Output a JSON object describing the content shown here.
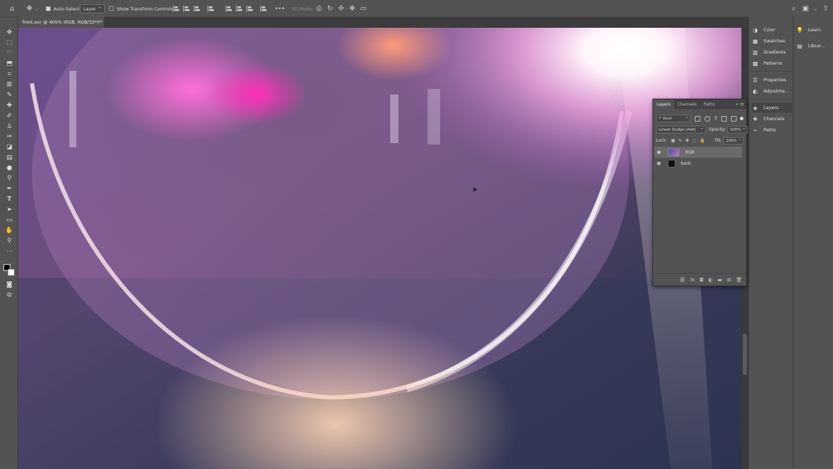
{
  "options_bar": {
    "auto_select_label": "Auto-Select:",
    "auto_select_target": "Layer",
    "transform_label": "Show Transform Controls",
    "more_label": "•••",
    "mode_label": "3D Mode:"
  },
  "document_tab": {
    "title": "front.exr @ 405% (RGB, RGB/32*) *",
    "close": "×"
  },
  "dock": {
    "items": [
      {
        "label": "Color",
        "icon": "color-wheel-icon"
      },
      {
        "label": "Swatches",
        "icon": "swatches-icon"
      },
      {
        "label": "Gradients",
        "icon": "gradients-icon"
      },
      {
        "label": "Patterns",
        "icon": "patterns-icon"
      },
      {
        "label": "Properties",
        "icon": "properties-icon"
      },
      {
        "label": "Adjustme...",
        "icon": "adjustments-icon"
      },
      {
        "label": "Layers",
        "icon": "layers-icon"
      },
      {
        "label": "Channels",
        "icon": "channels-icon"
      },
      {
        "label": "Paths",
        "icon": "paths-icon"
      }
    ],
    "right_items": [
      {
        "label": "Learn",
        "icon": "lightbulb-icon"
      },
      {
        "label": "Librar...",
        "icon": "libraries-icon"
      }
    ]
  },
  "layers_panel": {
    "tabs": [
      "Layers",
      "Channels",
      "Paths"
    ],
    "active_tab": "Layers",
    "filter_kind": "Kind",
    "blend_mode": "Linear Dodge (Add)",
    "opacity_label": "Opacity:",
    "opacity_value": "100%",
    "lock_label": "Lock:",
    "fill_label": "Fill:",
    "fill_value": "100%",
    "layers": [
      {
        "name": "RGB",
        "selected": true
      },
      {
        "name": "back",
        "selected": false
      }
    ]
  },
  "colors": {
    "ui_bg": "#535353",
    "panel_dark": "#3c3c3c",
    "selection": "#6a6a6a"
  }
}
